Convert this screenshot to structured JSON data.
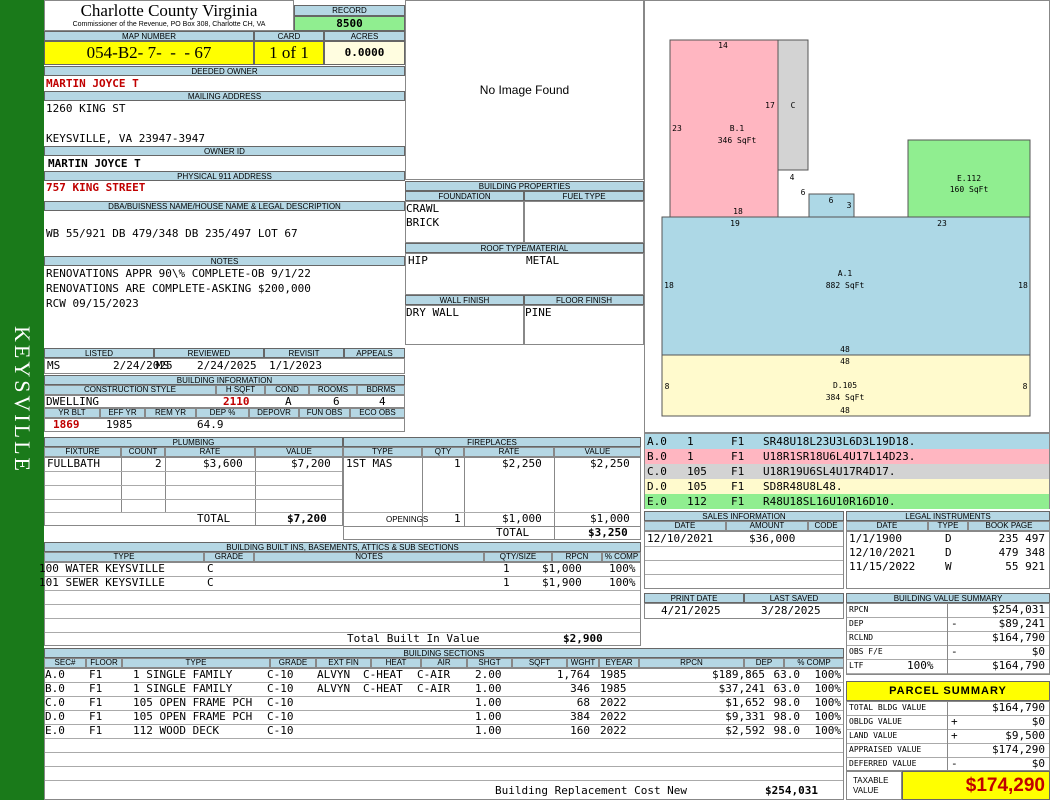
{
  "header": {
    "county": "Charlotte County Virginia",
    "office": "Commissioner of the Revenue, PO Box 308, Charlotte CH, VA",
    "record_label": "RECORD",
    "record": "8500",
    "map_label": "MAP NUMBER",
    "map_number": "054-B2- 7-  -  - 67",
    "card_label": "CARD",
    "card": "1 of 1",
    "acres_label": "ACRES",
    "acres": "0.0000"
  },
  "side_label": "KEYSVILLE",
  "owner": {
    "deeded_label": "DEEDED OWNER",
    "deeded": "MARTIN JOYCE T",
    "mailing_label": "MAILING ADDRESS",
    "addr1": "1260 KING ST",
    "addr2": "KEYSVILLE, VA 23947-3947",
    "owner_id_label": "OWNER ID",
    "owner_id": "MARTIN JOYCE T",
    "physical_label": "PHYSICAL 911 ADDRESS",
    "physical": "757 KING STREET",
    "dba_label": "DBA/BUISNESS NAME/HOUSE NAME & LEGAL DESCRIPTION",
    "legal": "WB 55/921 DB 479/348 DB 235/497 LOT 67",
    "notes_label": "NOTES",
    "notes1": "RENOVATIONS APPR 90\\% COMPLETE-OB 9/1/22",
    "notes2": "RENOVATIONS ARE COMPLETE-ASKING $200,000",
    "notes3": "RCW 09/15/2023"
  },
  "image_text": "No Image Found",
  "props": {
    "title": "BUILDING PROPERTIES",
    "foundation_label": "FOUNDATION",
    "fuel_label": "FUEL TYPE",
    "foundation1": "CRAWL",
    "foundation2": "BRICK",
    "roof_label": "ROOF TYPE/MATERIAL",
    "roof1": "HIP",
    "roof2": "METAL",
    "wall_label": "WALL FINISH",
    "floor_label": "FLOOR FINISH",
    "wall": "DRY WALL",
    "floor": "PINE"
  },
  "review": {
    "listed_label": "LISTED",
    "reviewed_label": "REVIEWED",
    "revisit_label": "REVISIT",
    "appeals_label": "APPEALS",
    "listed_by": "MS",
    "listed": "2/24/2025",
    "reviewed_by": "MS",
    "reviewed": "2/24/2025",
    "revisit": "1/1/2023"
  },
  "bldg_info": {
    "title": "BUILDING INFORMATION",
    "h": [
      "CONSTRUCTION STYLE",
      "H SQFT",
      "COND",
      "ROOMS",
      "BDRMS"
    ],
    "style": "DWELLING",
    "hsqft": "2110",
    "cond": "A",
    "rooms": "6",
    "bdrms": "4",
    "h2": [
      "YR BLT",
      "EFF YR",
      "REM YR",
      "DEP %",
      "DEPOVR",
      "FUN OBS",
      "ECO OBS"
    ],
    "yrblt": "1869",
    "effyr": "1985",
    "dep": "64.9"
  },
  "plumbing": {
    "title": "PLUMBING",
    "h": [
      "FIXTURE",
      "COUNT",
      "RATE",
      "VALUE"
    ],
    "fixture": "FULLBATH",
    "count": "2",
    "rate": "$3,600",
    "value": "$7,200",
    "total_label": "TOTAL",
    "total": "$7,200"
  },
  "fireplaces": {
    "title": "FIREPLACES",
    "h": [
      "TYPE",
      "QTY",
      "RATE",
      "VALUE"
    ],
    "type": "1ST MAS",
    "qty": "1",
    "rate": "$2,250",
    "value": "$2,250",
    "open_label": "OPENINGS",
    "open_qty": "1",
    "open_rate": "$1,000",
    "open_value": "$1,000",
    "total_label": "TOTAL",
    "total": "$3,250"
  },
  "builtins": {
    "title": "BUILDING BUILT INS, BASEMENTS, ATTICS & SUB SECTIONS",
    "h": [
      "TYPE",
      "GRADE",
      "NOTES",
      "QTY/SIZE",
      "RPCN",
      "% COMP"
    ],
    "rows": [
      [
        "100 WATER KEYSVILLE",
        "C",
        "",
        "1",
        "$1,000",
        "100%"
      ],
      [
        "101 SEWER KEYSVILLE",
        "C",
        "",
        "1",
        "$1,900",
        "100%"
      ]
    ],
    "total_label": "Total Built In Value",
    "total": "$2,900"
  },
  "sections": {
    "title": "BUILDING SECTIONS",
    "h": [
      "SEC#",
      "FLOOR",
      "TYPE",
      "GRADE",
      "EXT FIN",
      "HEAT",
      "AIR",
      "SHGT",
      "SQFT",
      "WGHT",
      "EYEAR",
      "RPCN",
      "DEP",
      "% COMP"
    ],
    "rows": [
      [
        "A.0",
        "F1",
        "1 SINGLE FAMILY",
        "C-10",
        "ALVYN",
        "C-HEAT",
        "C-AIR",
        "2.00",
        "1,764",
        "",
        "1985",
        "$189,865",
        "63.0",
        "100%"
      ],
      [
        "B.0",
        "F1",
        "1 SINGLE FAMILY",
        "C-10",
        "ALVYN",
        "C-HEAT",
        "C-AIR",
        "1.00",
        "346",
        "",
        "1985",
        "$37,241",
        "63.0",
        "100%"
      ],
      [
        "C.0",
        "F1",
        "105 OPEN FRAME PCH",
        "C-10",
        "",
        "",
        "",
        "1.00",
        "68",
        "",
        "2022",
        "$1,652",
        "98.0",
        "100%"
      ],
      [
        "D.0",
        "F1",
        "105 OPEN FRAME PCH",
        "C-10",
        "",
        "",
        "",
        "1.00",
        "384",
        "",
        "2022",
        "$9,331",
        "98.0",
        "100%"
      ],
      [
        "E.0",
        "F1",
        "112 WOOD DECK",
        "C-10",
        "",
        "",
        "",
        "1.00",
        "160",
        "",
        "2022",
        "$2,592",
        "98.0",
        "100%"
      ]
    ],
    "rcn_label": "Building Replacement Cost New",
    "rcn": "$254,031"
  },
  "sketch": {
    "a_label": "A.1",
    "a_area": "882 SqFt",
    "b_label": "B.1",
    "b_area": "346 SqFt",
    "c_label": "C",
    "d_label": "D.105",
    "d_area": "384 SqFt",
    "e_label": "E.112",
    "e_area": "160 SqFt",
    "dims": [
      "14",
      "17",
      "23",
      "4",
      "6",
      "6",
      "3",
      "18",
      "19",
      "23",
      "18",
      "18",
      "48",
      "48",
      "8",
      "8",
      "48"
    ],
    "colors": {
      "a": "#add8e6",
      "b": "#ffb6c1",
      "c": "#d3d3d3",
      "d": "#fffacd",
      "e": "#90ee90"
    }
  },
  "codes": [
    {
      "id": "A.0",
      "n": "1",
      "f": "F1",
      "code": "SR48U18L23U3L6D3L19D18."
    },
    {
      "id": "B.0",
      "n": "1",
      "f": "F1",
      "code": "U18R1SR18U6L4U17L14D23."
    },
    {
      "id": "C.0",
      "n": "105",
      "f": "F1",
      "code": "U18R19U6SL4U17R4D17."
    },
    {
      "id": "D.0",
      "n": "105",
      "f": "F1",
      "code": "SD8R48U8L48."
    },
    {
      "id": "E.0",
      "n": "112",
      "f": "F1",
      "code": "R48U18SL16U10R16D10."
    }
  ],
  "sales": {
    "title": "SALES INFORMATION",
    "h": [
      "DATE",
      "AMOUNT",
      "CODE"
    ],
    "date": "12/10/2021",
    "amount": "$36,000",
    "code": ""
  },
  "legal": {
    "title": "LEGAL INSTRUMENTS",
    "h": [
      "DATE",
      "TYPE",
      "BOOK PAGE"
    ],
    "rows": [
      [
        "1/1/1900",
        "D",
        "235 497"
      ],
      [
        "12/10/2021",
        "D",
        "479 348"
      ],
      [
        "11/15/2022",
        "W",
        "55 921"
      ]
    ]
  },
  "print": {
    "print_label": "PRINT DATE",
    "saved_label": "LAST SAVED",
    "print": "4/21/2025",
    "saved": "3/28/2025"
  },
  "bvs": {
    "title": "BUILDING VALUE SUMMARY",
    "rows": [
      [
        "RPCN",
        "",
        "$254,031"
      ],
      [
        "DEP",
        "-",
        "$89,241"
      ],
      [
        "RCLND",
        "",
        "$164,790"
      ],
      [
        "OBS F/E",
        "-",
        "$0"
      ],
      [
        "LTF",
        "100%",
        "$164,790"
      ]
    ]
  },
  "parcel": {
    "title": "PARCEL SUMMARY",
    "rows": [
      [
        "TOTAL BLDG VALUE",
        "",
        "$164,790"
      ],
      [
        "OBLDG VALUE",
        "+",
        "$0"
      ],
      [
        "LAND VALUE",
        "+",
        "$9,500"
      ],
      [
        "APPRAISED VALUE",
        "",
        "$174,290"
      ],
      [
        "DEFERRED VALUE",
        "-",
        "$0"
      ]
    ],
    "taxable_label1": "TAXABLE",
    "taxable_label2": "VALUE",
    "taxable": "$174,290"
  }
}
